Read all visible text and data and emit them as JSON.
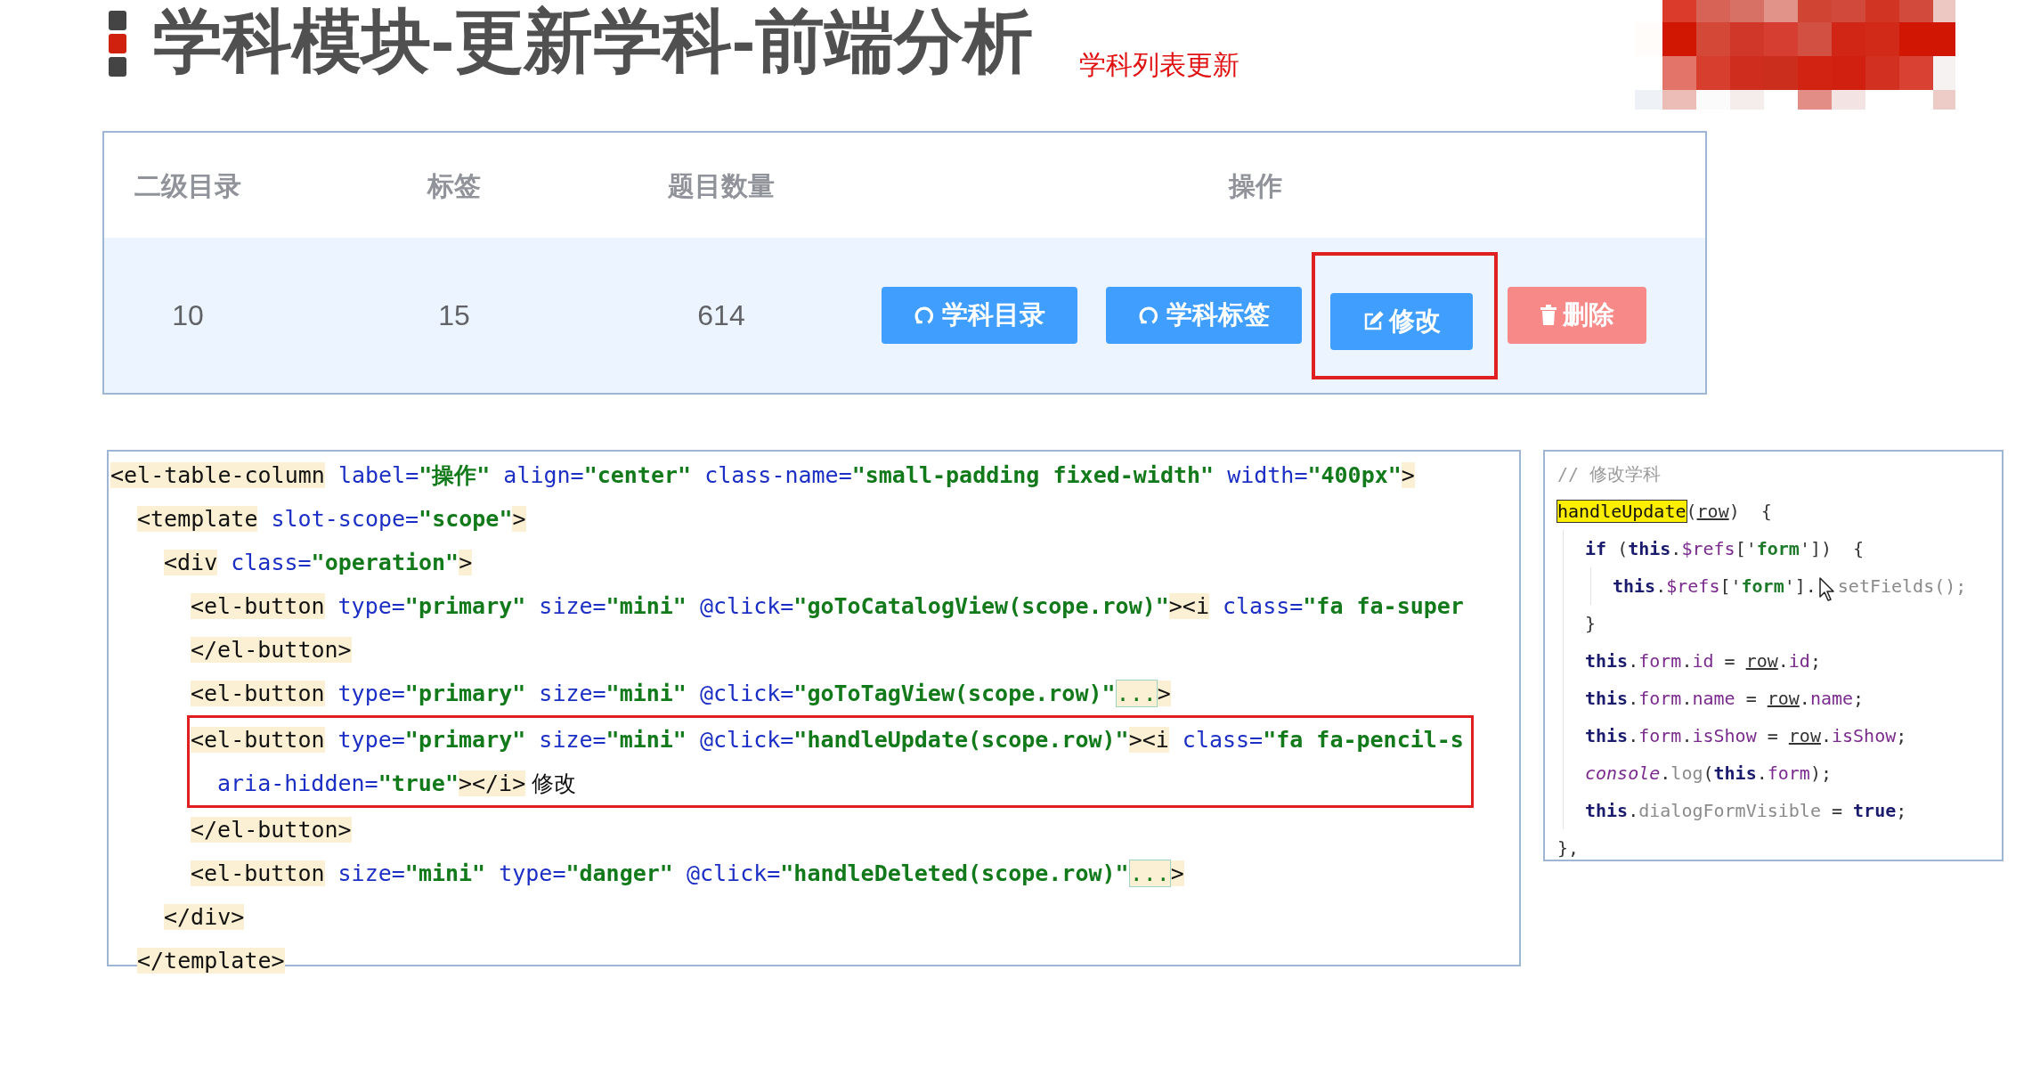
{
  "header": {
    "title": "学科模块-更新学科-前端分析",
    "subtitle": "学科列表更新"
  },
  "table": {
    "columns": [
      "二级目录",
      "标签",
      "题目数量",
      "操作"
    ],
    "rows": [
      {
        "cells": [
          "10",
          "15",
          "614"
        ],
        "actions": [
          {
            "label": "学科目录",
            "kind": "sync",
            "highlighted": false
          },
          {
            "label": "学科标签",
            "kind": "sync",
            "highlighted": false
          },
          {
            "label": "修改",
            "kind": "edit",
            "highlighted": true
          },
          {
            "label": "删除",
            "kind": "delete",
            "highlighted": false
          }
        ]
      }
    ]
  },
  "code_panel": {
    "lines": [
      {
        "highlighted": false,
        "segments": [
          {
            "kind": "tag",
            "text": "<el-table-column"
          },
          {
            "kind": "attr",
            "text": " label="
          },
          {
            "kind": "val",
            "text": "\"操作\""
          },
          {
            "kind": "attr",
            "text": " align="
          },
          {
            "kind": "val",
            "text": "\"center\""
          },
          {
            "kind": "attr",
            "text": " class-name="
          },
          {
            "kind": "val",
            "text": "\"small-padding fixed-width\""
          },
          {
            "kind": "attr",
            "text": " width="
          },
          {
            "kind": "val",
            "text": "\"400px\""
          },
          {
            "kind": "tag",
            "text": ">"
          }
        ],
        "children": [
          {
            "highlighted": false,
            "segments": [
              {
                "kind": "tag",
                "text": "<template"
              },
              {
                "kind": "attr",
                "text": " slot-scope="
              },
              {
                "kind": "val",
                "text": "\"scope\""
              },
              {
                "kind": "tag",
                "text": ">"
              }
            ],
            "children": [
              {
                "highlighted": false,
                "segments": [
                  {
                    "kind": "tag",
                    "text": "<div"
                  },
                  {
                    "kind": "attr",
                    "text": " class="
                  },
                  {
                    "kind": "val",
                    "text": "\"operation\""
                  },
                  {
                    "kind": "tag",
                    "text": ">"
                  }
                ],
                "children": [
                  {
                    "highlighted": false,
                    "segments": [
                      {
                        "kind": "tag",
                        "text": "<el-button"
                      },
                      {
                        "kind": "attr",
                        "text": " type="
                      },
                      {
                        "kind": "val",
                        "text": "\"primary\""
                      },
                      {
                        "kind": "attr",
                        "text": " size="
                      },
                      {
                        "kind": "val",
                        "text": "\"mini\""
                      },
                      {
                        "kind": "attr",
                        "text": " @click="
                      },
                      {
                        "kind": "val",
                        "text": "\"goToCatalogView(scope.row)\""
                      },
                      {
                        "kind": "tag",
                        "text": "><i"
                      },
                      {
                        "kind": "attr",
                        "text": " class="
                      },
                      {
                        "kind": "val",
                        "text": "\"fa fa-super"
                      }
                    ]
                  },
                  {
                    "highlighted": false,
                    "segments": [
                      {
                        "kind": "tag",
                        "text": "</el-button>"
                      }
                    ]
                  },
                  {
                    "highlighted": false,
                    "segments": [
                      {
                        "kind": "tag",
                        "text": "<el-button"
                      },
                      {
                        "kind": "attr",
                        "text": " type="
                      },
                      {
                        "kind": "val",
                        "text": "\"primary\""
                      },
                      {
                        "kind": "attr",
                        "text": " size="
                      },
                      {
                        "kind": "val",
                        "text": "\"mini\""
                      },
                      {
                        "kind": "attr",
                        "text": " @click="
                      },
                      {
                        "kind": "val",
                        "text": "\"goToTagView(scope.row)\""
                      },
                      {
                        "kind": "fold",
                        "text": "..."
                      },
                      {
                        "kind": "tag",
                        "text": ">"
                      }
                    ]
                  },
                  {
                    "highlighted": true,
                    "segments": [
                      {
                        "kind": "tag",
                        "text": "<el-button"
                      },
                      {
                        "kind": "attr",
                        "text": " type="
                      },
                      {
                        "kind": "val",
                        "text": "\"primary\""
                      },
                      {
                        "kind": "attr",
                        "text": " size="
                      },
                      {
                        "kind": "val",
                        "text": "\"mini\""
                      },
                      {
                        "kind": "attr",
                        "text": " @click="
                      },
                      {
                        "kind": "val",
                        "text": "\"handleUpdate(scope.row)\""
                      },
                      {
                        "kind": "tag",
                        "text": "><i"
                      },
                      {
                        "kind": "attr",
                        "text": " class="
                      },
                      {
                        "kind": "val",
                        "text": "\"fa fa-pencil-s"
                      }
                    ],
                    "children": [
                      {
                        "highlighted": false,
                        "segments": [
                          {
                            "kind": "attr",
                            "text": "aria-hidden="
                          },
                          {
                            "kind": "val",
                            "text": "\"true\""
                          },
                          {
                            "kind": "tag",
                            "text": "></i>"
                          },
                          {
                            "kind": "plain",
                            "text": " 修改"
                          }
                        ]
                      }
                    ]
                  },
                  {
                    "highlighted": false,
                    "segments": [
                      {
                        "kind": "tag",
                        "text": "</el-button>"
                      }
                    ]
                  },
                  {
                    "highlighted": false,
                    "segments": [
                      {
                        "kind": "tag",
                        "text": "<el-button"
                      },
                      {
                        "kind": "attr",
                        "text": " size="
                      },
                      {
                        "kind": "val",
                        "text": "\"mini\""
                      },
                      {
                        "kind": "attr",
                        "text": " type="
                      },
                      {
                        "kind": "val",
                        "text": "\"danger\""
                      },
                      {
                        "kind": "attr",
                        "text": " @click="
                      },
                      {
                        "kind": "val",
                        "text": "\"handleDeleted(scope.row)\""
                      },
                      {
                        "kind": "fold",
                        "text": "..."
                      },
                      {
                        "kind": "tag",
                        "text": ">"
                      }
                    ]
                  }
                ]
              },
              {
                "highlighted": false,
                "segments": [
                  {
                    "kind": "tag",
                    "text": "</div>"
                  }
                ]
              }
            ]
          },
          {
            "highlighted": false,
            "segments": [
              {
                "kind": "tag",
                "text": "</template>"
              }
            ]
          }
        ]
      }
    ]
  },
  "snippet_panel": {
    "lines": [
      {
        "segments": [
          {
            "kind": "comment",
            "text": "// 修改学科"
          }
        ]
      },
      {
        "segments": [
          {
            "kind": "found",
            "text": "handleUpdate"
          },
          {
            "kind": "plain",
            "text": "("
          },
          {
            "kind": "under",
            "text": "row"
          },
          {
            "kind": "plain",
            "text": ")  {"
          }
        ],
        "children": [
          {
            "segments": [
              {
                "kind": "kw",
                "text": "if"
              },
              {
                "kind": "plain",
                "text": " ("
              },
              {
                "kind": "kw",
                "text": "this"
              },
              {
                "kind": "plain",
                "text": "."
              },
              {
                "kind": "prop",
                "text": "$refs"
              },
              {
                "kind": "plain",
                "text": "['"
              },
              {
                "kind": "str",
                "text": "form"
              },
              {
                "kind": "plain",
                "text": "'])  {"
              }
            ],
            "children": [
              {
                "segments": [
                  {
                    "kind": "kw",
                    "text": "this"
                  },
                  {
                    "kind": "plain",
                    "text": "."
                  },
                  {
                    "kind": "prop",
                    "text": "$refs"
                  },
                  {
                    "kind": "plain",
                    "text": "['"
                  },
                  {
                    "kind": "str",
                    "text": "form"
                  },
                  {
                    "kind": "plain",
                    "text": "']."
                  },
                  {
                    "kind": "cursor"
                  },
                  {
                    "kind": "dim",
                    "text": "setFields();"
                  }
                ]
              }
            ]
          },
          {
            "segments": [
              {
                "kind": "plain",
                "text": "}"
              }
            ]
          },
          {
            "segments": [
              {
                "kind": "kw",
                "text": "this"
              },
              {
                "kind": "plain",
                "text": "."
              },
              {
                "kind": "prop",
                "text": "form"
              },
              {
                "kind": "plain",
                "text": "."
              },
              {
                "kind": "prop",
                "text": "id"
              },
              {
                "kind": "plain",
                "text": " = "
              },
              {
                "kind": "under",
                "text": "row"
              },
              {
                "kind": "plain",
                "text": "."
              },
              {
                "kind": "prop",
                "text": "id"
              },
              {
                "kind": "plain",
                "text": ";"
              }
            ]
          },
          {
            "segments": [
              {
                "kind": "kw",
                "text": "this"
              },
              {
                "kind": "plain",
                "text": "."
              },
              {
                "kind": "prop",
                "text": "form"
              },
              {
                "kind": "plain",
                "text": "."
              },
              {
                "kind": "prop",
                "text": "name"
              },
              {
                "kind": "plain",
                "text": " = "
              },
              {
                "kind": "under",
                "text": "row"
              },
              {
                "kind": "plain",
                "text": "."
              },
              {
                "kind": "prop",
                "text": "name"
              },
              {
                "kind": "plain",
                "text": ";"
              }
            ]
          },
          {
            "segments": [
              {
                "kind": "kw",
                "text": "this"
              },
              {
                "kind": "plain",
                "text": "."
              },
              {
                "kind": "prop",
                "text": "form"
              },
              {
                "kind": "plain",
                "text": "."
              },
              {
                "kind": "prop",
                "text": "isShow"
              },
              {
                "kind": "plain",
                "text": " = "
              },
              {
                "kind": "under",
                "text": "row"
              },
              {
                "kind": "plain",
                "text": "."
              },
              {
                "kind": "prop",
                "text": "isShow"
              },
              {
                "kind": "plain",
                "text": ";"
              }
            ]
          },
          {
            "segments": [
              {
                "kind": "ital",
                "text": "console"
              },
              {
                "kind": "plain",
                "text": "."
              },
              {
                "kind": "dim",
                "text": "log"
              },
              {
                "kind": "plain",
                "text": "("
              },
              {
                "kind": "kw",
                "text": "this"
              },
              {
                "kind": "plain",
                "text": "."
              },
              {
                "kind": "prop",
                "text": "form"
              },
              {
                "kind": "plain",
                "text": ");"
              }
            ]
          },
          {
            "segments": [
              {
                "kind": "kw",
                "text": "this"
              },
              {
                "kind": "plain",
                "text": "."
              },
              {
                "kind": "dim",
                "text": "dialogFormVisible"
              },
              {
                "kind": "plain",
                "text": " = "
              },
              {
                "kind": "kw",
                "text": "true"
              },
              {
                "kind": "plain",
                "text": ";"
              }
            ]
          }
        ]
      },
      {
        "segments": [
          {
            "kind": "plain",
            "text": "},"
          }
        ]
      }
    ]
  }
}
